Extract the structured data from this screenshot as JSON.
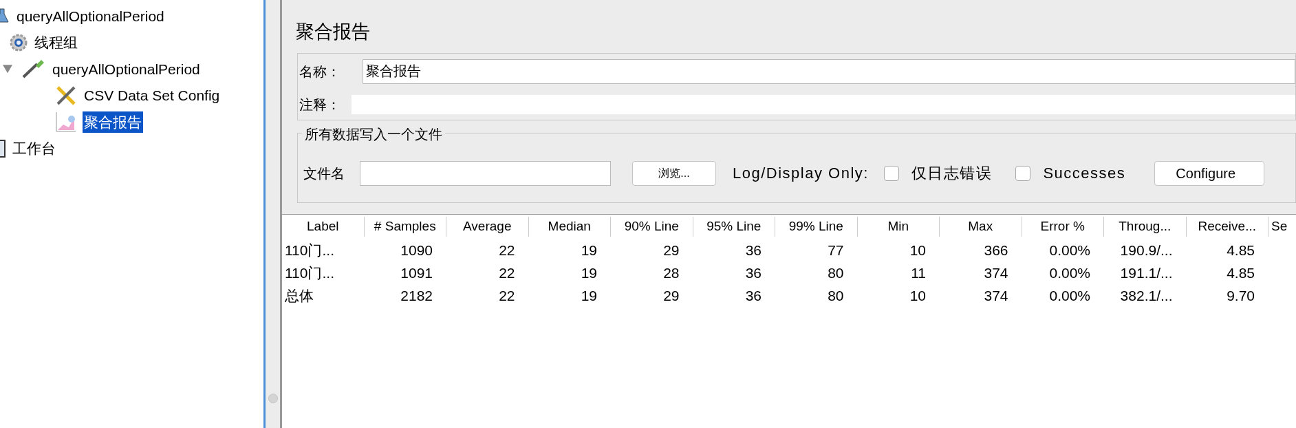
{
  "tree": [
    {
      "label": "queryAllOptionalPeriod",
      "kind": "flask",
      "selected": false,
      "children": [
        {
          "label": "线程组",
          "kind": "gear",
          "selected": false,
          "children": [
            {
              "label": "queryAllOptionalPeriod",
              "kind": "pipette",
              "selected": false,
              "expanded": true,
              "children": [
                {
                  "label": "CSV Data Set Config",
                  "kind": "tools",
                  "selected": false
                },
                {
                  "label": "聚合报告",
                  "kind": "chart",
                  "selected": true
                }
              ]
            }
          ]
        }
      ]
    },
    {
      "label": "工作台",
      "kind": "clipboard",
      "selected": false
    }
  ],
  "panel": {
    "title": "聚合报告",
    "name_label": "名称：",
    "name_value": "聚合报告",
    "comment_label": "注释：",
    "file_group": {
      "legend": "所有数据写入一个文件",
      "file_label": "文件名",
      "browse_button": "浏览...",
      "log_label": "Log/Display Only:",
      "checkboxes": [
        {
          "label": "仅日志错误",
          "checked": false
        },
        {
          "label": "Successes",
          "checked": false
        }
      ],
      "configure_button": "Configure"
    }
  },
  "table": {
    "columns": [
      "Label",
      "# Samples",
      "Average",
      "Median",
      "90% Line",
      "95% Line",
      "99% Line",
      "Min",
      "Max",
      "Error %",
      "Throug...",
      "Receive...",
      "Se"
    ],
    "rows": [
      [
        "110门...",
        "1090",
        "22",
        "19",
        "29",
        "36",
        "77",
        "10",
        "366",
        "0.00%",
        "190.9/...",
        "4.85",
        ""
      ],
      [
        "110门...",
        "1091",
        "22",
        "19",
        "28",
        "36",
        "80",
        "11",
        "374",
        "0.00%",
        "191.1/...",
        "4.85",
        ""
      ],
      [
        "总体",
        "2182",
        "22",
        "19",
        "29",
        "36",
        "80",
        "10",
        "374",
        "0.00%",
        "382.1/...",
        "9.70",
        ""
      ]
    ]
  }
}
